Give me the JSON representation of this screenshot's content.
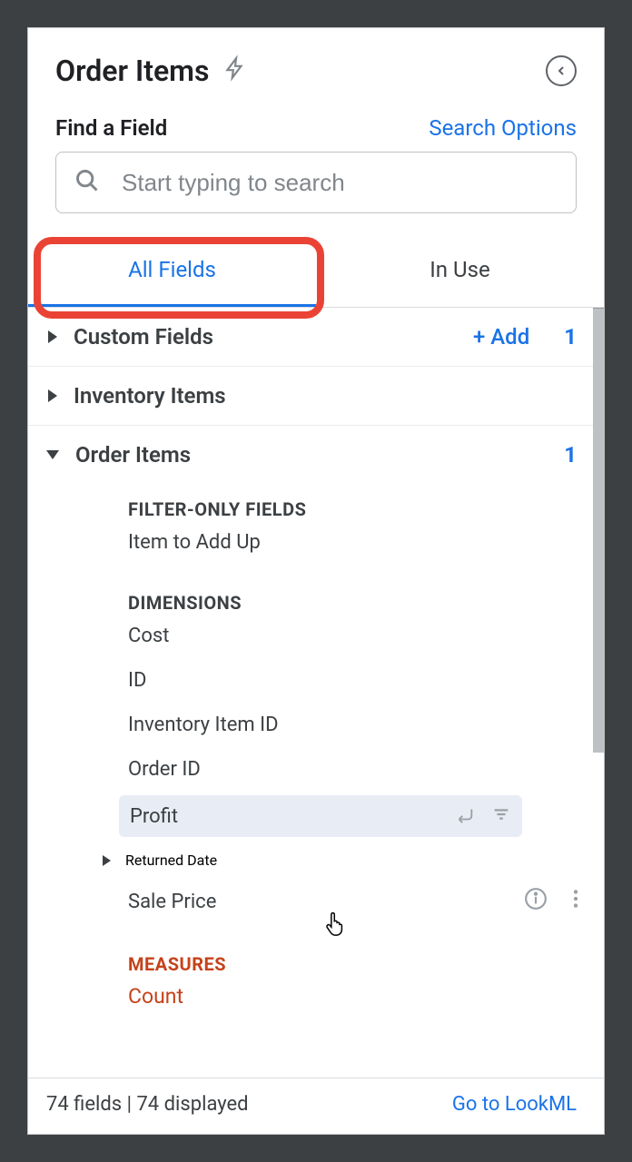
{
  "header": {
    "title": "Order Items"
  },
  "search": {
    "find_label": "Find a Field",
    "options_label": "Search Options",
    "placeholder": "Start typing to search"
  },
  "tabs": {
    "all_fields": "All Fields",
    "in_use": "In Use"
  },
  "sections": {
    "custom_fields": {
      "label": "Custom Fields",
      "add_label": "+  Add",
      "count": "1"
    },
    "inventory_items": {
      "label": "Inventory Items"
    },
    "order_items": {
      "label": "Order Items",
      "count": "1"
    }
  },
  "subsections": {
    "filter_only": "FILTER-ONLY FIELDS",
    "dimensions": "DIMENSIONS",
    "measures": "MEASURES"
  },
  "fields": {
    "item_to_add_up": "Item to Add Up",
    "cost": "Cost",
    "id": "ID",
    "inventory_item_id": "Inventory Item ID",
    "order_id": "Order ID",
    "profit": "Profit",
    "returned_date": "Returned Date",
    "sale_price": "Sale Price",
    "count": "Count"
  },
  "footer": {
    "summary": "74 fields | 74 displayed",
    "lookml_link": "Go to LookML"
  }
}
